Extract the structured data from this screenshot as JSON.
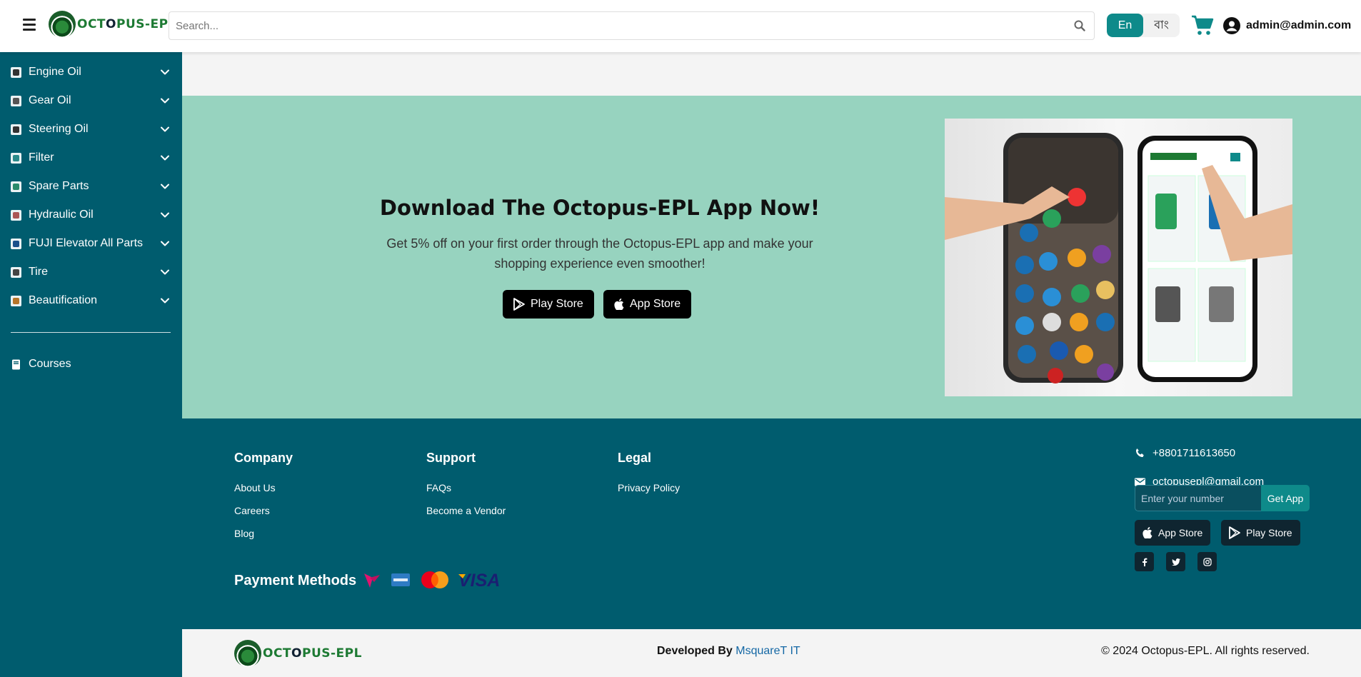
{
  "header": {
    "logo_text_a": "OCT",
    "logo_text_b": "O",
    "logo_text_c": "PUS-EPL",
    "search_placeholder": "Search...",
    "lang_en": "En",
    "lang_bn": "বাং",
    "user_email": "admin@admin.com"
  },
  "sidebar": {
    "items": [
      {
        "label": "Engine Oil"
      },
      {
        "label": "Gear Oil"
      },
      {
        "label": "Steering Oil"
      },
      {
        "label": "Filter"
      },
      {
        "label": "Spare Parts"
      },
      {
        "label": "Hydraulic Oil"
      },
      {
        "label": "FUJI Elevator All Parts"
      },
      {
        "label": "Tire"
      },
      {
        "label": "Beautification"
      }
    ],
    "courses": "Courses"
  },
  "banner": {
    "title": "Download The Octopus-EPL App Now!",
    "text_line1": "Get 5% off on your first order through the Octopus-EPL app and make your",
    "text_line2": "shopping experience even smoother!",
    "play_store": "Play Store",
    "app_store": "App Store"
  },
  "footer": {
    "company_title": "Company",
    "company_links": [
      "About Us",
      "Careers",
      "Blog"
    ],
    "support_title": "Support",
    "support_links": [
      "FAQs",
      "Become a Vendor"
    ],
    "legal_title": "Legal",
    "legal_links": [
      "Privacy Policy"
    ],
    "payment_title": "Payment Methods",
    "phone": "+8801711613650",
    "email": "octopusepl@gmail.com",
    "number_placeholder": "Enter your number",
    "get_app": "Get App",
    "app_store": "App Store",
    "play_store": "Play Store"
  },
  "bottom": {
    "developed_by": "Developed By",
    "developer": "MsquareT IT",
    "copyright": "© 2024 Octopus-EPL. All rights reserved."
  },
  "colors": {
    "primary": "#005c6e",
    "banner": "#97d3bf",
    "accent": "#0e8a8a"
  }
}
